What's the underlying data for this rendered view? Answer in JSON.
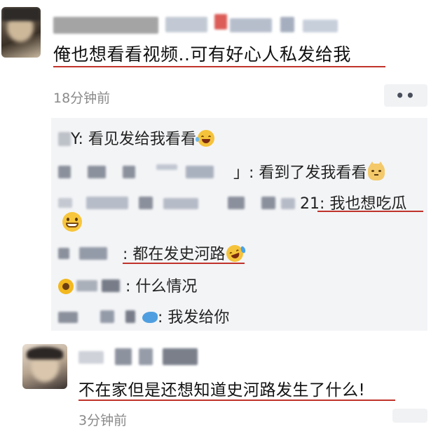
{
  "post1": {
    "message": "俺也想看看视频..可有好心人私发给我",
    "time": "18分钟前",
    "more_label": "••"
  },
  "replies": [
    {
      "name": "Y",
      "text": ": 看见发给我看看",
      "emoji": "laughing-tears-icon"
    },
    {
      "name": "」",
      "text": ": 看到了发我看看",
      "emoji": "cat-face-icon"
    },
    {
      "name": "21",
      "text": ": 我也想吃瓜",
      "emoji": "grinning-face-icon"
    },
    {
      "name": "",
      "text": ": 都在发史河路",
      "emoji": "laughing-crying-icon"
    },
    {
      "name": "",
      "text": ": 什么情况",
      "emoji": "sunflower-icon"
    },
    {
      "name": "",
      "text": ": 我发给你",
      "emoji": "dolphin-icon"
    }
  ],
  "post2": {
    "message": "不在家但是还想知道史河路发生了什么!",
    "time": "3分钟前"
  },
  "colors": {
    "underline": "#c0332b",
    "reply_bg": "#f3f4f6",
    "time": "#8a8a8a"
  }
}
